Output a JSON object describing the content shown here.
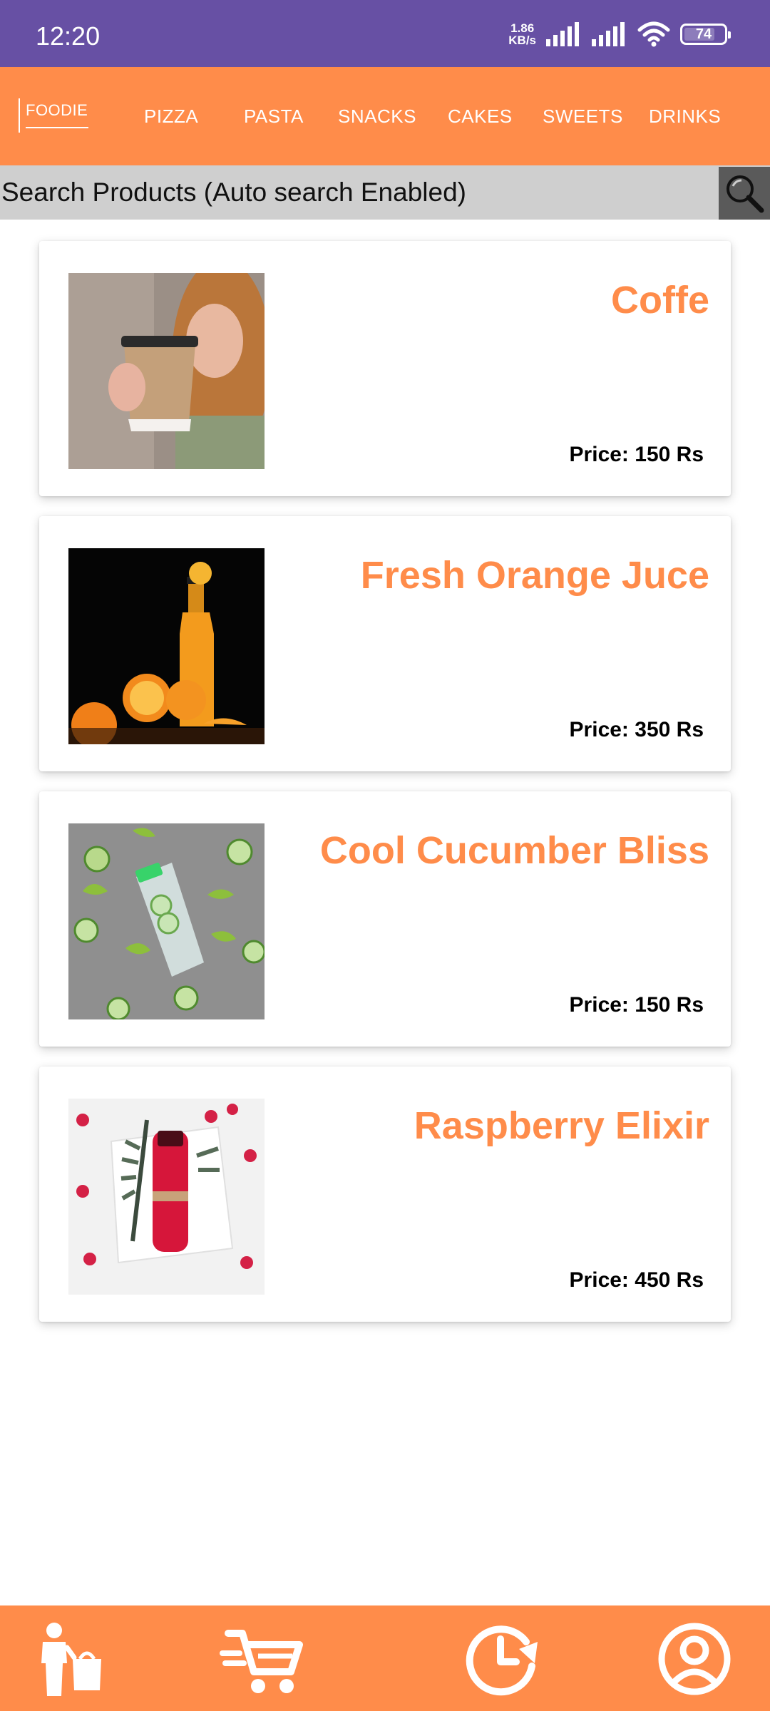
{
  "status_bar": {
    "time": "12:20",
    "net_speed_value": "1.86",
    "net_speed_unit": "KB/s",
    "battery_level": "74"
  },
  "nav": {
    "logo_text": "FOODIE",
    "categories": [
      "PIZZA",
      "PASTA",
      "SNACKS",
      "CAKES",
      "SWEETS",
      "DRINKS"
    ]
  },
  "search": {
    "placeholder": "Search Products (Auto search Enabled)",
    "icon": "search-icon"
  },
  "products": [
    {
      "name": "Coffe",
      "price": "Price: 150 Rs",
      "image": "coffee-cup-photo"
    },
    {
      "name": "Fresh Orange Juce",
      "price": "Price: 350 Rs",
      "image": "orange-juice-photo"
    },
    {
      "name": "Cool Cucumber Bliss",
      "price": "Price: 150 Rs",
      "image": "cucumber-drink-photo"
    },
    {
      "name": "Raspberry Elixir",
      "price": "Price: 450 Rs",
      "image": "raspberry-drink-photo"
    }
  ],
  "bottom_nav": {
    "items": [
      "shop-icon",
      "cart-icon",
      "history-icon",
      "profile-icon"
    ]
  },
  "colors": {
    "status_bar": "#6750a4",
    "accent": "#ff8c4a",
    "search_bg": "#cfcfcf",
    "search_button": "#5a5a5a"
  }
}
